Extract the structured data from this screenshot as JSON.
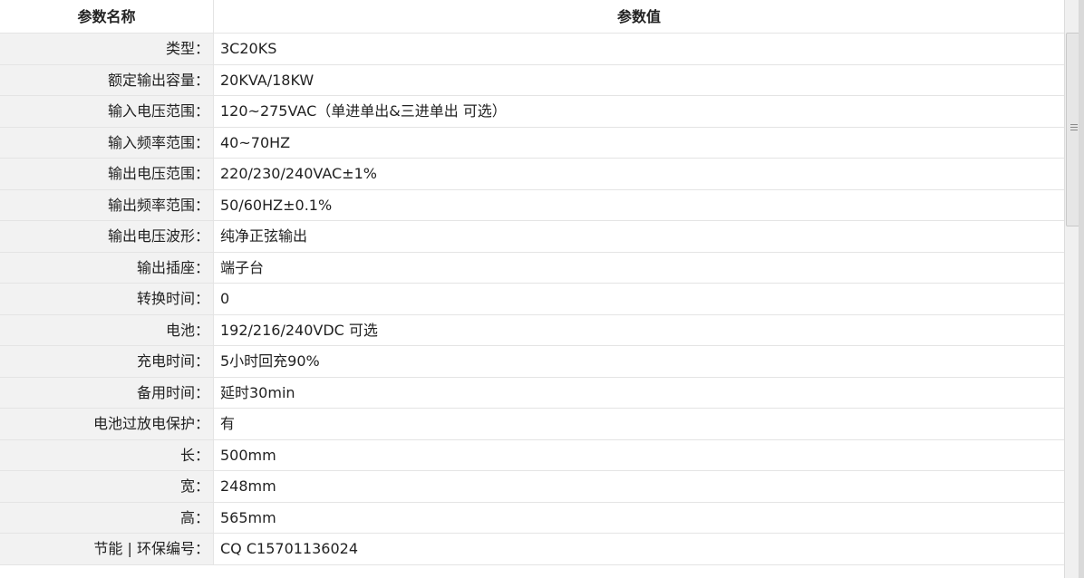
{
  "table": {
    "headers": {
      "name": "参数名称",
      "value": "参数值"
    },
    "rows": [
      {
        "name": "类型：",
        "value": "3C20KS"
      },
      {
        "name": "额定输出容量：",
        "value": "20KVA/18KW"
      },
      {
        "name": "输入电压范围：",
        "value": "120~275VAC（单进单出&三进单出 可选）"
      },
      {
        "name": "输入频率范围：",
        "value": "40~70HZ"
      },
      {
        "name": "输出电压范围：",
        "value": "220/230/240VAC±1%"
      },
      {
        "name": "输出频率范围：",
        "value": "50/60HZ±0.1%"
      },
      {
        "name": "输出电压波形：",
        "value": "纯净正弦输出"
      },
      {
        "name": "输出插座：",
        "value": "端子台"
      },
      {
        "name": "转换时间：",
        "value": "0"
      },
      {
        "name": "电池：",
        "value": "192/216/240VDC 可选"
      },
      {
        "name": "充电时间：",
        "value": "5小时回充90%"
      },
      {
        "name": "备用时间：",
        "value": "延时30min"
      },
      {
        "name": "电池过放电保护：",
        "value": "有"
      },
      {
        "name": "长：",
        "value": "500mm"
      },
      {
        "name": "宽：",
        "value": "248mm"
      },
      {
        "name": "高：",
        "value": "565mm"
      },
      {
        "name": "节能 | 环保编号：",
        "value": "CQ C15701136024"
      }
    ]
  },
  "scrollbar": {
    "grip_icon": "scroll-grip-icon"
  }
}
